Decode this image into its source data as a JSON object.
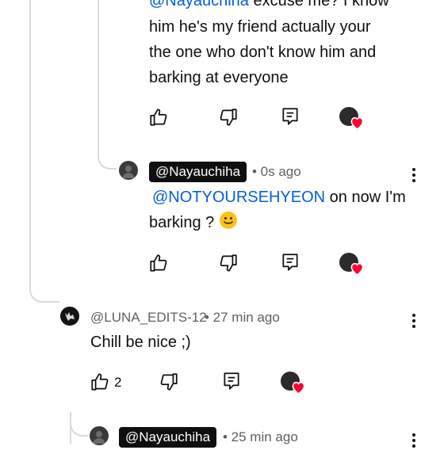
{
  "comment1": {
    "line1_mention": "@Nayauchiha",
    "line1_rest": " excuse me? I know",
    "line2": "him he's my friend actually your",
    "line3": "the one who don't know him and",
    "line4": "barking at everyone"
  },
  "comment2": {
    "author": "@Nayauchiha",
    "time": " • 0s ago",
    "mention": "@NOTYOURSEHYEON",
    "text_rest": " on now I'm",
    "line2": "barking ?",
    "emoji": "slightly-smiling-face"
  },
  "comment3": {
    "author": "@LUNA_EDITS-12",
    "time": " • 27 min ago",
    "text": "Chill be nice ;)",
    "like_count": "2"
  },
  "comment4": {
    "author": "@Nayauchiha",
    "time": " • 25 min ago"
  },
  "icons": {
    "like": "thumbs-up-icon",
    "dislike": "thumbs-down-icon",
    "reply": "reply-comment-icon",
    "creator_heart": "creator-heart-icon",
    "more": "more-vert-icon"
  },
  "colors": {
    "mention": "#065fd4",
    "heart": "#ff0033",
    "chip_bg": "#0f0f0f"
  }
}
